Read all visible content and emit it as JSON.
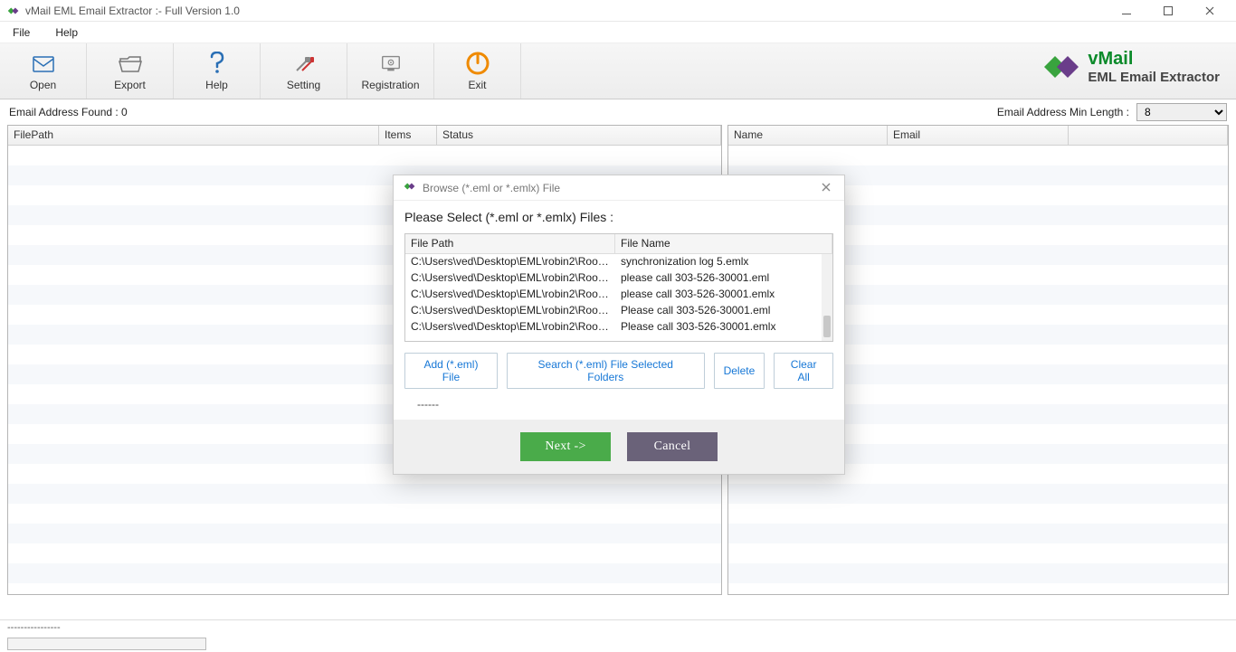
{
  "titlebar": {
    "title": "vMail EML Email Extractor :- Full Version 1.0"
  },
  "menubar": {
    "file": "File",
    "help": "Help"
  },
  "toolbar": {
    "open": "Open",
    "export": "Export",
    "help": "Help",
    "setting": "Setting",
    "registration": "Registration",
    "exit": "Exit"
  },
  "brand": {
    "name": "vMail",
    "sub": "EML Email Extractor"
  },
  "inforow": {
    "found_label": "Email Address Found :  0",
    "minlen_label": "Email Address Min Length :",
    "minlen_value": "8"
  },
  "gridleft": {
    "col_filepath": "FilePath",
    "col_items": "Items",
    "col_status": "Status"
  },
  "gridright": {
    "col_name": "Name",
    "col_email": "Email"
  },
  "statusbar": {
    "text": "----------------"
  },
  "dialog": {
    "title": "Browse (*.eml or *.emlx) File",
    "heading": "Please Select (*.eml or *.emlx) Files :",
    "col_filepath": "File Path",
    "col_filename": "File Name",
    "rows": [
      {
        "path": "C:\\Users\\ved\\Desktop\\EML\\robin2\\Root-Ma...",
        "name": "synchronization log 5.emlx"
      },
      {
        "path": "C:\\Users\\ved\\Desktop\\EML\\robin2\\Root-Ma...",
        "name": "please call 303-526-30001.eml"
      },
      {
        "path": "C:\\Users\\ved\\Desktop\\EML\\robin2\\Root-Ma...",
        "name": "please call 303-526-30001.emlx"
      },
      {
        "path": "C:\\Users\\ved\\Desktop\\EML\\robin2\\Root-Ma...",
        "name": "Please call 303-526-30001.eml"
      },
      {
        "path": "C:\\Users\\ved\\Desktop\\EML\\robin2\\Root-Ma...",
        "name": "Please call 303-526-30001.emlx"
      }
    ],
    "btn_add": "Add (*.eml) File",
    "btn_search": "Search (*.eml) File Selected Folders",
    "btn_delete": "Delete",
    "btn_clear": "Clear All",
    "status": "------",
    "btn_next": "Next  ->",
    "btn_cancel": "Cancel"
  }
}
